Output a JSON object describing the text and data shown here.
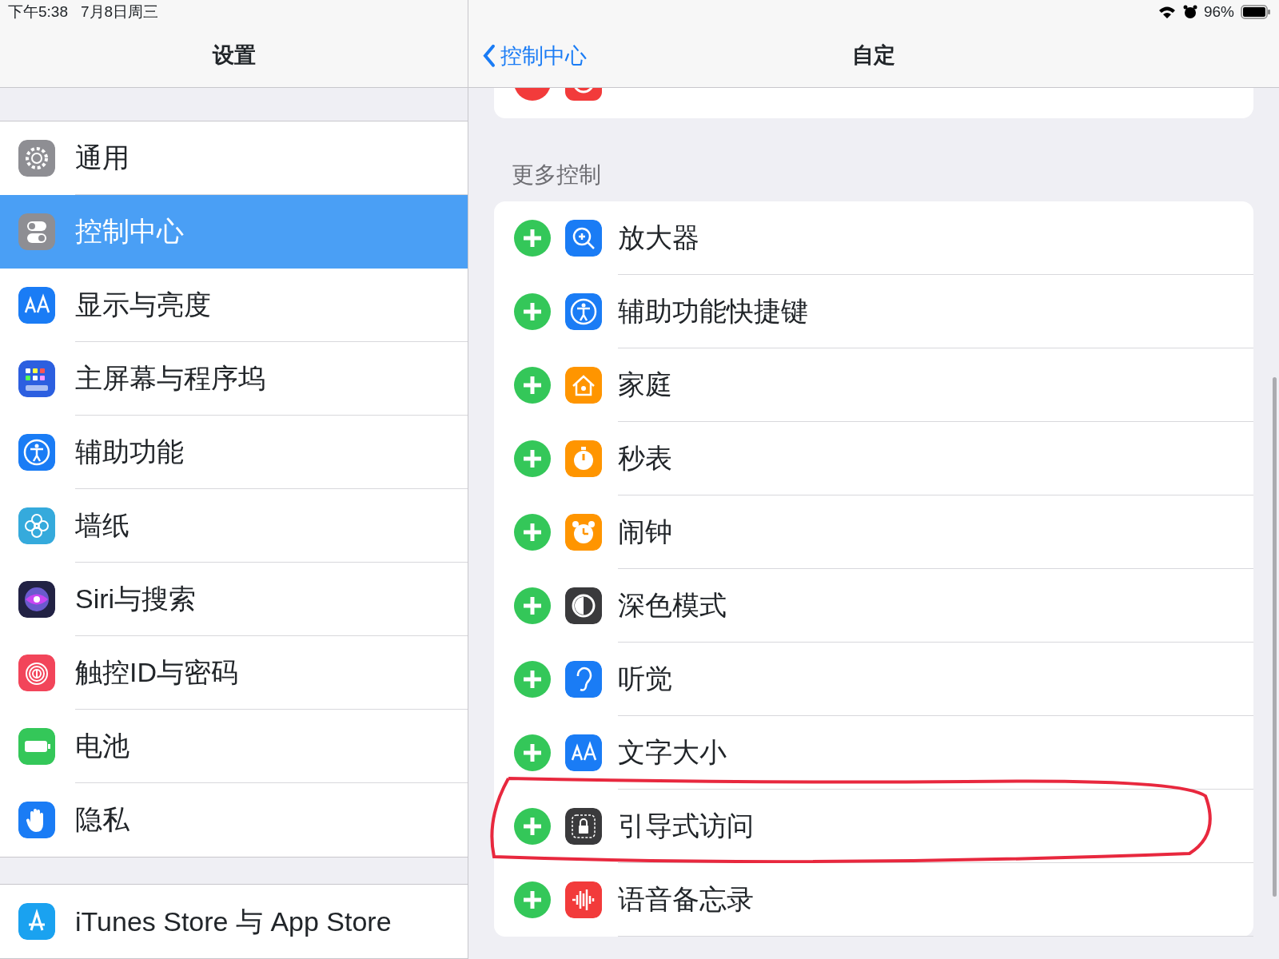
{
  "status_bar": {
    "time": "下午5:38",
    "date": "7月8日周三",
    "battery": "96%",
    "alarm": true
  },
  "sidebar": {
    "title": "设置",
    "items": [
      {
        "label": "通用",
        "color": "#8e8e93",
        "selected": false
      },
      {
        "label": "控制中心",
        "color": "#8e8e93",
        "selected": true
      },
      {
        "label": "显示与亮度",
        "color": "#1a7cf5",
        "selected": false
      },
      {
        "label": "主屏幕与程序坞",
        "color": "#2c5fe0",
        "selected": false
      },
      {
        "label": "辅助功能",
        "color": "#1a7cf5",
        "selected": false
      },
      {
        "label": "墙纸",
        "color": "#35aadc",
        "selected": false
      },
      {
        "label": "Siri与搜索",
        "color": "#222244",
        "selected": false
      },
      {
        "label": "触控ID与密码",
        "color": "#f2455a",
        "selected": false
      },
      {
        "label": "电池",
        "color": "#34c759",
        "selected": false
      },
      {
        "label": "隐私",
        "color": "#1a7cf5",
        "selected": false
      }
    ],
    "more_items": [
      {
        "label": "iTunes Store 与 App Store",
        "color": "#1aa2f0",
        "selected": false
      }
    ]
  },
  "detail": {
    "back": "控制中心",
    "title": "自定",
    "included_items": [
      {
        "color": "#f23b3b"
      }
    ],
    "section": "更多控制",
    "items": [
      {
        "label": "放大器",
        "color": "#1a7cf5",
        "highlighted": false
      },
      {
        "label": "辅助功能快捷键",
        "color": "#1a7cf5",
        "highlighted": false
      },
      {
        "label": "家庭",
        "color": "#ff9500",
        "highlighted": false
      },
      {
        "label": "秒表",
        "color": "#ff9500",
        "highlighted": false
      },
      {
        "label": "闹钟",
        "color": "#ff9500",
        "highlighted": false
      },
      {
        "label": "深色模式",
        "color": "#3a3a3c",
        "highlighted": false
      },
      {
        "label": "听觉",
        "color": "#1a7cf5",
        "highlighted": false
      },
      {
        "label": "文字大小",
        "color": "#1a7cf5",
        "highlighted": false
      },
      {
        "label": "引导式访问",
        "color": "#3a3a3c",
        "highlighted": true
      },
      {
        "label": "语音备忘录",
        "color": "#f23b3b",
        "highlighted": false
      }
    ]
  }
}
